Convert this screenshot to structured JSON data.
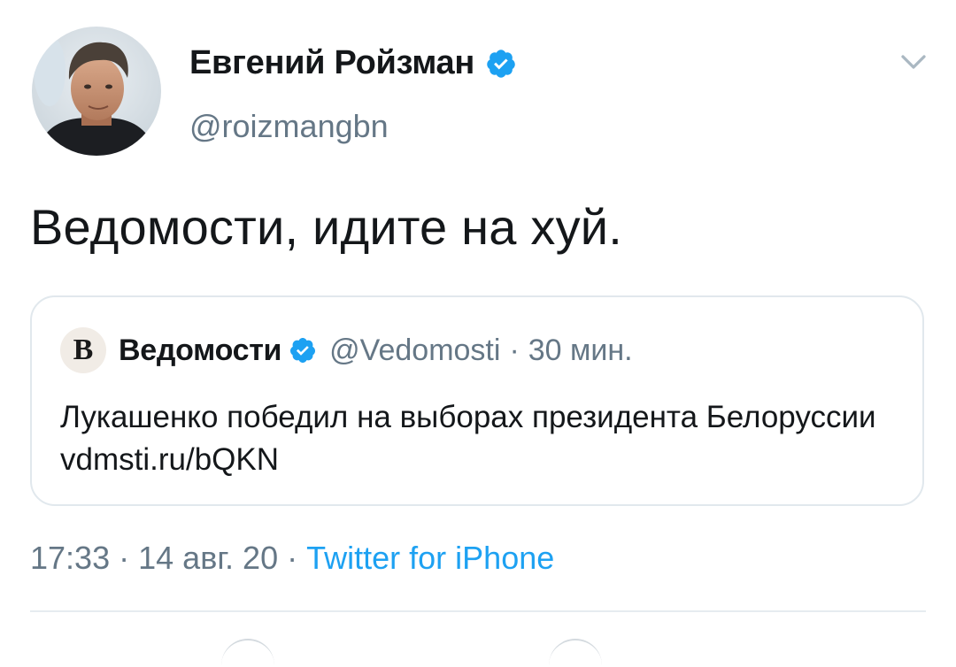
{
  "author": {
    "name": "Евгений Ройзман",
    "handle": "@roizmangbn",
    "verified": true
  },
  "tweet": {
    "text": "Ведомости, идите на хуй."
  },
  "quoted": {
    "logo_letter": "В",
    "name": "Ведомости",
    "verified": true,
    "handle": "@Vedomosti",
    "separator": "·",
    "time": "30 мин.",
    "text": "Лукашенко победил на выборах президента Белоруссии vdmsti.ru/bQKN"
  },
  "meta": {
    "time": "17:33",
    "sep1": "·",
    "date": "14 авг. 20",
    "sep2": "·",
    "source": "Twitter for iPhone"
  },
  "colors": {
    "accent": "#1da1f2",
    "secondary_text": "#657786",
    "border": "#e1e8ed"
  },
  "icons": [
    "verified-badge-icon",
    "chevron-down-icon",
    "vedomosti-logo"
  ]
}
